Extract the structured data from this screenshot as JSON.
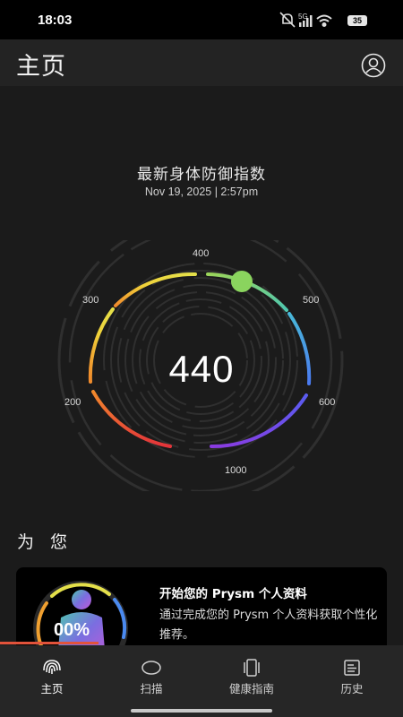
{
  "status_bar": {
    "time": "18:03",
    "network": "5G",
    "battery": "35",
    "icons": [
      "mute-icon",
      "signal-icon",
      "wifi-icon",
      "battery-icon"
    ]
  },
  "header": {
    "title": "主页",
    "profile_icon": "user-circle-icon"
  },
  "score": {
    "title": "最新身体防御指数",
    "date": "Nov 19, 2025 | 2:57pm",
    "value": "440",
    "ticks": [
      "200",
      "300",
      "400",
      "500",
      "600",
      "1000"
    ]
  },
  "for_you": {
    "title": "为 您",
    "card": {
      "title": "开始您的 Prysm 个人资料",
      "description": "通过完成您的 Prysm 个人资料获取个性化推荐。",
      "thumb_text": "00%"
    }
  },
  "bottom_nav": [
    {
      "label": "主页",
      "icon": "fingerprint-icon",
      "active": true
    },
    {
      "label": "扫描",
      "icon": "scan-oval-icon",
      "active": false
    },
    {
      "label": "健康指南",
      "icon": "cards-icon",
      "active": false
    },
    {
      "label": "历史",
      "icon": "history-icon",
      "active": false
    }
  ],
  "colors": {
    "background": "#1b1b1b",
    "header": "#232323",
    "nav": "#262626",
    "gauge_indicator": "#8ad45e",
    "accent_red": "#e2533b"
  }
}
